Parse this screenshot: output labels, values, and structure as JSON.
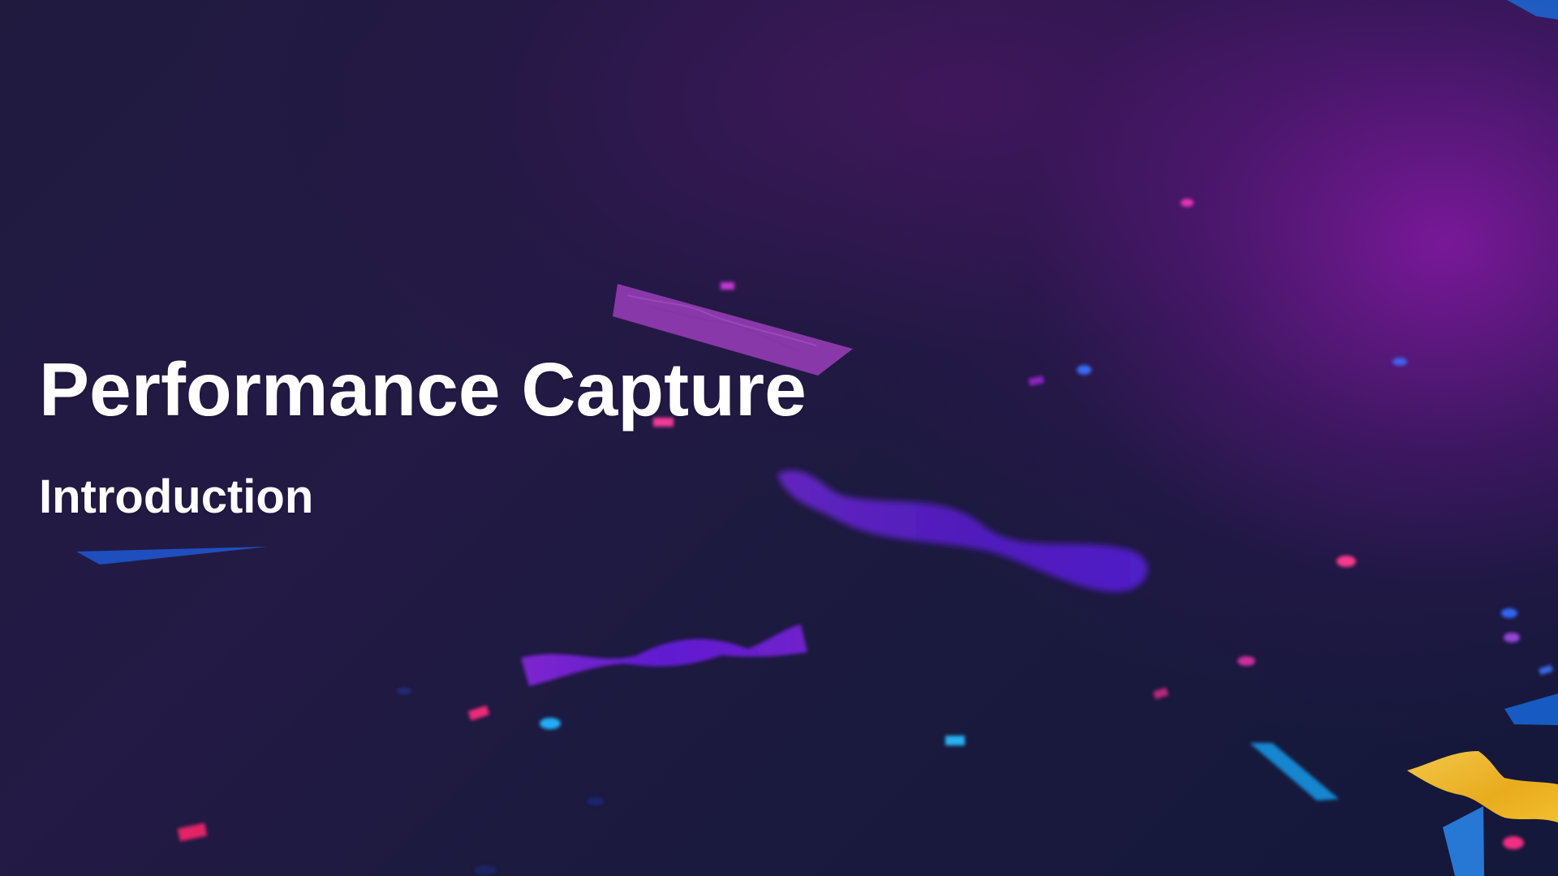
{
  "slide": {
    "title": "Performance Capture",
    "subtitle": "Introduction"
  },
  "colors": {
    "background_dark": "#171a33",
    "background_purple": "#a019be",
    "text_primary": "#ffffff",
    "confetti_blue": "#1f74ff",
    "confetti_purple": "#6d18e8",
    "confetti_pink": "#ff2f92",
    "confetti_yellow": "#ffc21a"
  }
}
